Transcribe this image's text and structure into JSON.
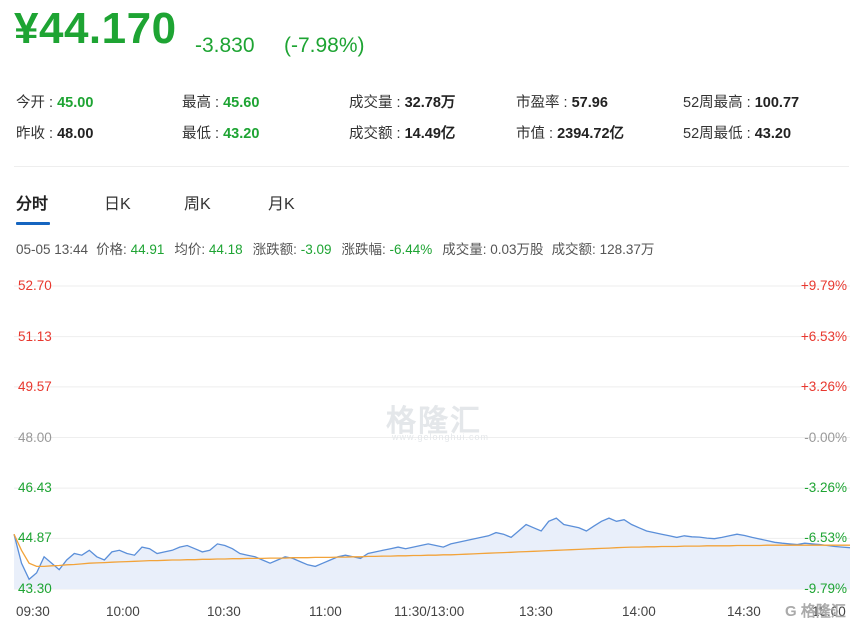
{
  "quote": {
    "price": "¥44.170",
    "change": "-3.830",
    "change_pct": "(-7.98%)",
    "color": "#1ea433"
  },
  "stats": [
    {
      "label": "今开 : ",
      "value": "45.00",
      "tone": "green"
    },
    {
      "label": "最高 : ",
      "value": "45.60",
      "tone": "green"
    },
    {
      "label": "成交量 : ",
      "value": "32.78万",
      "tone": "dark"
    },
    {
      "label": "市盈率 : ",
      "value": "57.96",
      "tone": "dark"
    },
    {
      "label": "52周最高 : ",
      "value": "100.77",
      "tone": "dark"
    },
    {
      "label": "昨收 : ",
      "value": "48.00",
      "tone": "dark"
    },
    {
      "label": "最低 : ",
      "value": "43.20",
      "tone": "green"
    },
    {
      "label": "成交额 : ",
      "value": "14.49亿",
      "tone": "dark"
    },
    {
      "label": "市值 : ",
      "value": "2394.72亿",
      "tone": "dark"
    },
    {
      "label": "52周最低 : ",
      "value": "43.20",
      "tone": "dark"
    }
  ],
  "tabs": [
    "分时",
    "日K",
    "周K",
    "月K"
  ],
  "info": {
    "datetime": "05-05 13:44",
    "price_label": "价格: ",
    "price": "44.91",
    "avg_label": "均价: ",
    "avg": "44.18",
    "chg_label": "涨跌额: ",
    "chg": "-3.09",
    "pct_label": "涨跌幅: ",
    "pct": "-6.44%",
    "vol": "成交量: 0.03万股",
    "amt": "成交额: 128.37万"
  },
  "watermark": "格隆汇",
  "watermark_sub": "www.gelonghui.com",
  "logo": "G 格隆汇",
  "chart_data": {
    "type": "line",
    "y_left_ticks": [
      "52.70",
      "51.13",
      "49.57",
      "48.00",
      "46.43",
      "44.87",
      "43.30"
    ],
    "y_right_ticks": [
      "+9.79%",
      "+6.53%",
      "+3.26%",
      "-0.00%",
      "-3.26%",
      "-6.53%",
      "-9.79%"
    ],
    "x_ticks": [
      "09:30",
      "10:00",
      "10:30",
      "11:00",
      "11:30/13:00",
      "13:30",
      "14:00",
      "14:30",
      "15:00"
    ],
    "ylim": [
      43.3,
      52.7
    ],
    "prev_close": 48.0,
    "colors": {
      "price": "#5b8fd9",
      "avg": "#f2a33a",
      "fill": "#e9effa",
      "up": "#e8382f",
      "down": "#1ea433",
      "flat": "#999999"
    },
    "series": [
      {
        "values": [
          45.0,
          44.1,
          43.6,
          43.8,
          44.3,
          44.1,
          43.9,
          44.2,
          44.4,
          44.35,
          44.5,
          44.3,
          44.2,
          44.45,
          44.5,
          44.4,
          44.35,
          44.6,
          44.55,
          44.4,
          44.45,
          44.5,
          44.6,
          44.65,
          44.55,
          44.45,
          44.5,
          44.7,
          44.65,
          44.55,
          44.4,
          44.35,
          44.3,
          44.2,
          44.1,
          44.2,
          44.3,
          44.25,
          44.15,
          44.05,
          44.0,
          44.1,
          44.2,
          44.3,
          44.35,
          44.3,
          44.25,
          44.4,
          44.45,
          44.5,
          44.55,
          44.6,
          44.55,
          44.6,
          44.65,
          44.7,
          44.65,
          44.6,
          44.7,
          44.75,
          44.8,
          44.85,
          44.9,
          44.95,
          45.05,
          45.0,
          44.9,
          45.1,
          45.3,
          45.2,
          45.1,
          45.4,
          45.5,
          45.3,
          45.25,
          45.2,
          45.1,
          45.25,
          45.4,
          45.5,
          45.4,
          45.45,
          45.3,
          45.2,
          45.1,
          45.05,
          45.0,
          44.95,
          44.9,
          44.95,
          44.92,
          44.91,
          44.88,
          44.86,
          44.9,
          44.95,
          45.0,
          44.96,
          44.9,
          44.85,
          44.8,
          44.75,
          44.72,
          44.7,
          44.68,
          44.72,
          44.7,
          44.68,
          44.65,
          44.62,
          44.6,
          44.58
        ]
      },
      {
        "values": [
          45.0,
          44.5,
          44.1,
          44.0,
          44.0,
          44.02,
          44.03,
          44.05,
          44.06,
          44.08,
          44.1,
          44.11,
          44.12,
          44.13,
          44.14,
          44.15,
          44.16,
          44.17,
          44.18,
          44.18,
          44.19,
          44.2,
          44.2,
          44.21,
          44.21,
          44.22,
          44.22,
          44.23,
          44.23,
          44.24,
          44.24,
          44.25,
          44.25,
          44.25,
          44.26,
          44.26,
          44.26,
          44.27,
          44.27,
          44.27,
          44.28,
          44.28,
          44.28,
          44.29,
          44.29,
          44.3,
          44.3,
          44.31,
          44.31,
          44.32,
          44.32,
          44.33,
          44.33,
          44.34,
          44.34,
          44.35,
          44.35,
          44.36,
          44.36,
          44.37,
          44.38,
          44.39,
          44.4,
          44.41,
          44.42,
          44.43,
          44.44,
          44.45,
          44.46,
          44.47,
          44.48,
          44.49,
          44.5,
          44.51,
          44.52,
          44.53,
          44.54,
          44.55,
          44.56,
          44.57,
          44.58,
          44.59,
          44.6,
          44.6,
          44.61,
          44.61,
          44.62,
          44.62,
          44.62,
          44.63,
          44.63,
          44.63,
          44.64,
          44.64,
          44.64,
          44.64,
          44.65,
          44.65,
          44.65,
          44.65,
          44.66,
          44.66,
          44.66,
          44.66,
          44.66,
          44.66,
          44.66,
          44.66,
          44.66,
          44.66,
          44.66,
          44.66
        ]
      }
    ]
  }
}
